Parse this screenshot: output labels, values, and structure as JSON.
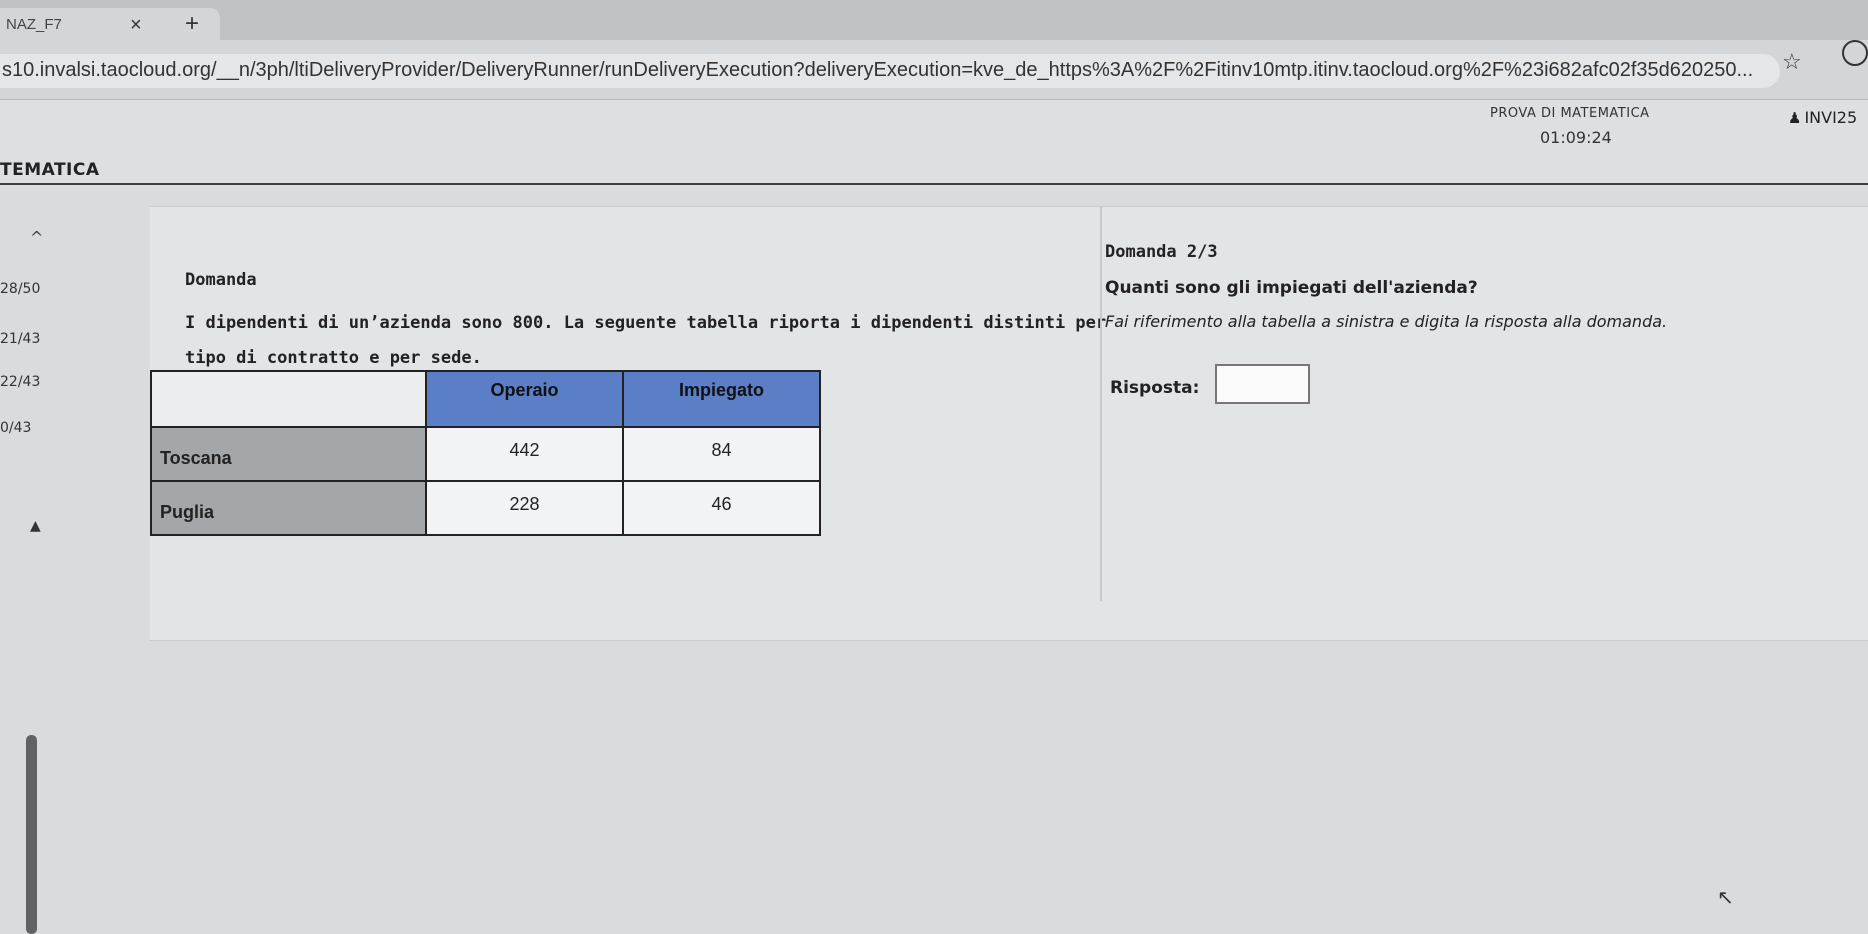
{
  "browser": {
    "tab_title": "NAZ_F7",
    "tab_close": "×",
    "new_tab": "+",
    "url": "s10.invalsi.taocloud.org/__n/3ph/ltiDeliveryProvider/DeliveryRunner/runDeliveryExecution?deliveryExecution=kve_de_https%3A%2F%2Fitinv10mtp.itinv.taocloud.org%2F%23i682afc02f35d620250...",
    "bookmark_icon": "☆"
  },
  "header": {
    "subject": "TEMATICA",
    "exam_title": "PROVA DI MATEMATICA",
    "timer": "01:09:24",
    "user_icon": "user-icon",
    "user_code": "INVI25"
  },
  "nav": {
    "up": "^",
    "items": [
      "28/50",
      "21/43",
      "22/43",
      "0/43"
    ],
    "down": "▲"
  },
  "question": {
    "heading": "Domanda",
    "text": "I dipendenti di un’azienda sono 800. La seguente tabella riporta i dipendenti distinti per tipo di contratto e per sede.",
    "table": {
      "columns": [
        "Operaio",
        "Impiegato"
      ],
      "rows": [
        {
          "label": "Toscana",
          "values": [
            "442",
            "84"
          ]
        },
        {
          "label": "Puglia",
          "values": [
            "228",
            "46"
          ]
        }
      ]
    }
  },
  "answer": {
    "count": "Domanda 2/3",
    "question": "Quanti sono gli impiegati dell'azienda?",
    "instruction": "Fai riferimento alla tabella a sinistra e digita la risposta alla domanda.",
    "label": "Risposta:",
    "value": ""
  },
  "colors": {
    "table_header": "#5a7fc7",
    "row_header": "#a4a7aa",
    "page_bg": "#d9dcde"
  }
}
